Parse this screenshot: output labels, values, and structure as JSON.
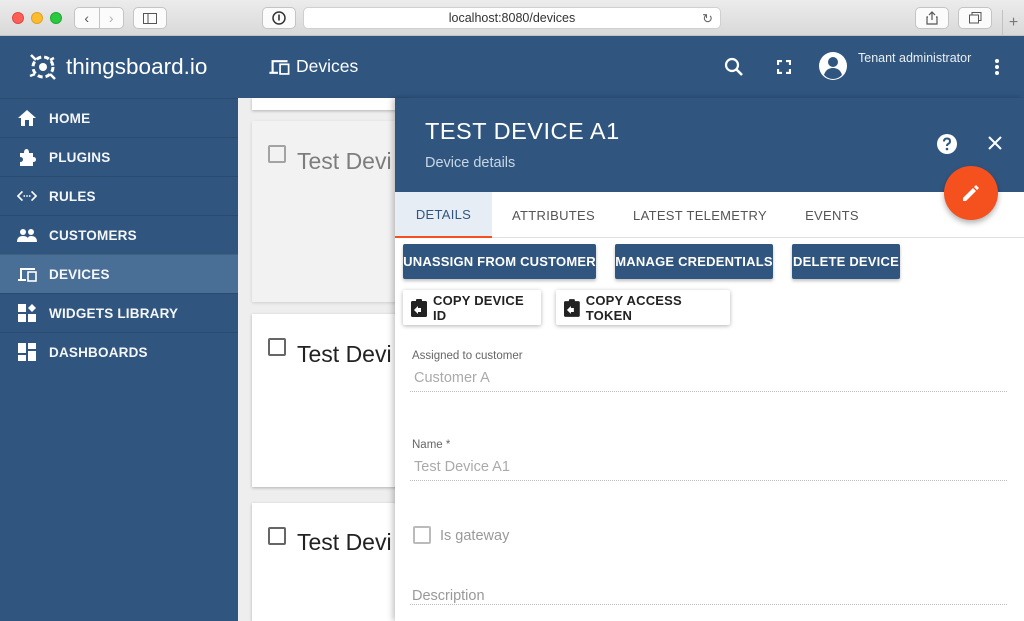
{
  "browser": {
    "url": "localhost:8080/devices"
  },
  "sidebar": {
    "logo_text": "thingsboard.io",
    "items": [
      {
        "label": "HOME",
        "icon": "home-icon"
      },
      {
        "label": "PLUGINS",
        "icon": "puzzle-icon"
      },
      {
        "label": "RULES",
        "icon": "code-icon"
      },
      {
        "label": "CUSTOMERS",
        "icon": "people-icon"
      },
      {
        "label": "DEVICES",
        "icon": "devices-icon",
        "active": true
      },
      {
        "label": "WIDGETS LIBRARY",
        "icon": "widgets-icon"
      },
      {
        "label": "DASHBOARDS",
        "icon": "dashboard-icon"
      }
    ]
  },
  "header": {
    "title": "Devices",
    "user_role": "Tenant administrator"
  },
  "cards": [
    {
      "title": "Test Devi"
    },
    {
      "title": "Test Devi"
    },
    {
      "title": "Test Devi"
    }
  ],
  "panel": {
    "title": "TEST DEVICE A1",
    "subtitle": "Device details",
    "tabs": [
      "DETAILS",
      "ATTRIBUTES",
      "LATEST TELEMETRY",
      "EVENTS"
    ],
    "buttons": {
      "unassign": "UNASSIGN FROM CUSTOMER",
      "credentials": "MANAGE CREDENTIALS",
      "delete": "DELETE DEVICE",
      "copy_id": "COPY DEVICE ID",
      "copy_token": "COPY ACCESS TOKEN"
    },
    "fields": {
      "customer_label": "Assigned to customer",
      "customer_value": "Customer A",
      "name_label": "Name *",
      "name_value": "Test Device A1",
      "gateway_label": "Is gateway",
      "description_label": "Description"
    }
  },
  "colors": {
    "primary": "#305680",
    "accent": "#f4511e"
  }
}
